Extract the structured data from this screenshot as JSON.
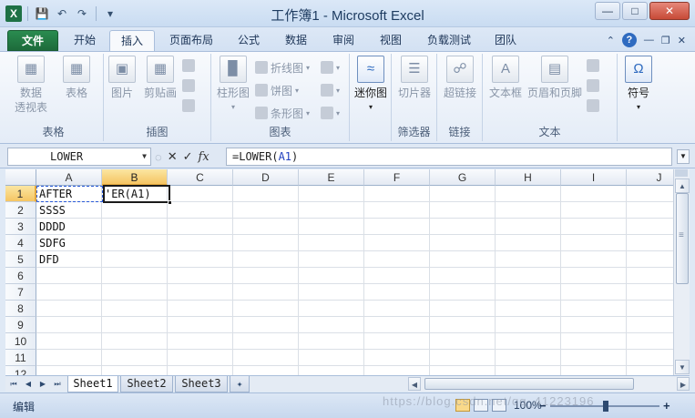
{
  "window": {
    "title": "工作簿1 - Microsoft Excel",
    "app_icon": "X"
  },
  "tabs": [
    {
      "label": "文件"
    },
    {
      "label": "开始"
    },
    {
      "label": "插入"
    },
    {
      "label": "页面布局"
    },
    {
      "label": "公式"
    },
    {
      "label": "数据"
    },
    {
      "label": "审阅"
    },
    {
      "label": "视图"
    },
    {
      "label": "负载测试"
    },
    {
      "label": "团队"
    }
  ],
  "ribbon": {
    "groups": {
      "tables": "表格",
      "illustrations": "插图",
      "charts": "图表",
      "filter": "筛选器",
      "links": "链接",
      "text": "文本"
    },
    "buttons": {
      "pivot_line1": "数据",
      "pivot_line2": "透视表",
      "table": "表格",
      "picture": "图片",
      "clipart": "剪贴画",
      "column_chart": "柱形图",
      "line_chart": "折线图",
      "pie_chart": "饼图",
      "bar_chart": "条形图",
      "sparkline": "迷你图",
      "slicer": "切片器",
      "hyperlink": "超链接",
      "textbox": "文本框",
      "header_footer": "页眉和页脚",
      "symbol": "符号"
    }
  },
  "formula_bar": {
    "name_box": "LOWER",
    "formula_prefix": "=LOWER(",
    "formula_ref": "A1",
    "formula_suffix": ")",
    "fx": "fx"
  },
  "grid": {
    "columns": [
      "A",
      "B",
      "C",
      "D",
      "E",
      "F",
      "G",
      "H",
      "I",
      "J"
    ],
    "rows": [
      "1",
      "2",
      "3",
      "4",
      "5",
      "6",
      "7",
      "8",
      "9",
      "10",
      "11",
      "12"
    ],
    "cells": {
      "A1": "AFTER",
      "A2": "SSSS",
      "A3": "DDDD",
      "A4": "SDFG",
      "A5": "DFD",
      "B1": "'ER(A1)"
    },
    "active_cell": "B1"
  },
  "sheets": [
    {
      "label": "Sheet1"
    },
    {
      "label": "Sheet2"
    },
    {
      "label": "Sheet3"
    }
  ],
  "status": {
    "mode": "编辑",
    "zoom": "100%",
    "watermark": "https://blog.csdn.net/qq_41223196"
  },
  "colors": {
    "file_tab": "#1d6b3b",
    "selection_header": "#f5c563",
    "reference": "#1f3fbf"
  }
}
